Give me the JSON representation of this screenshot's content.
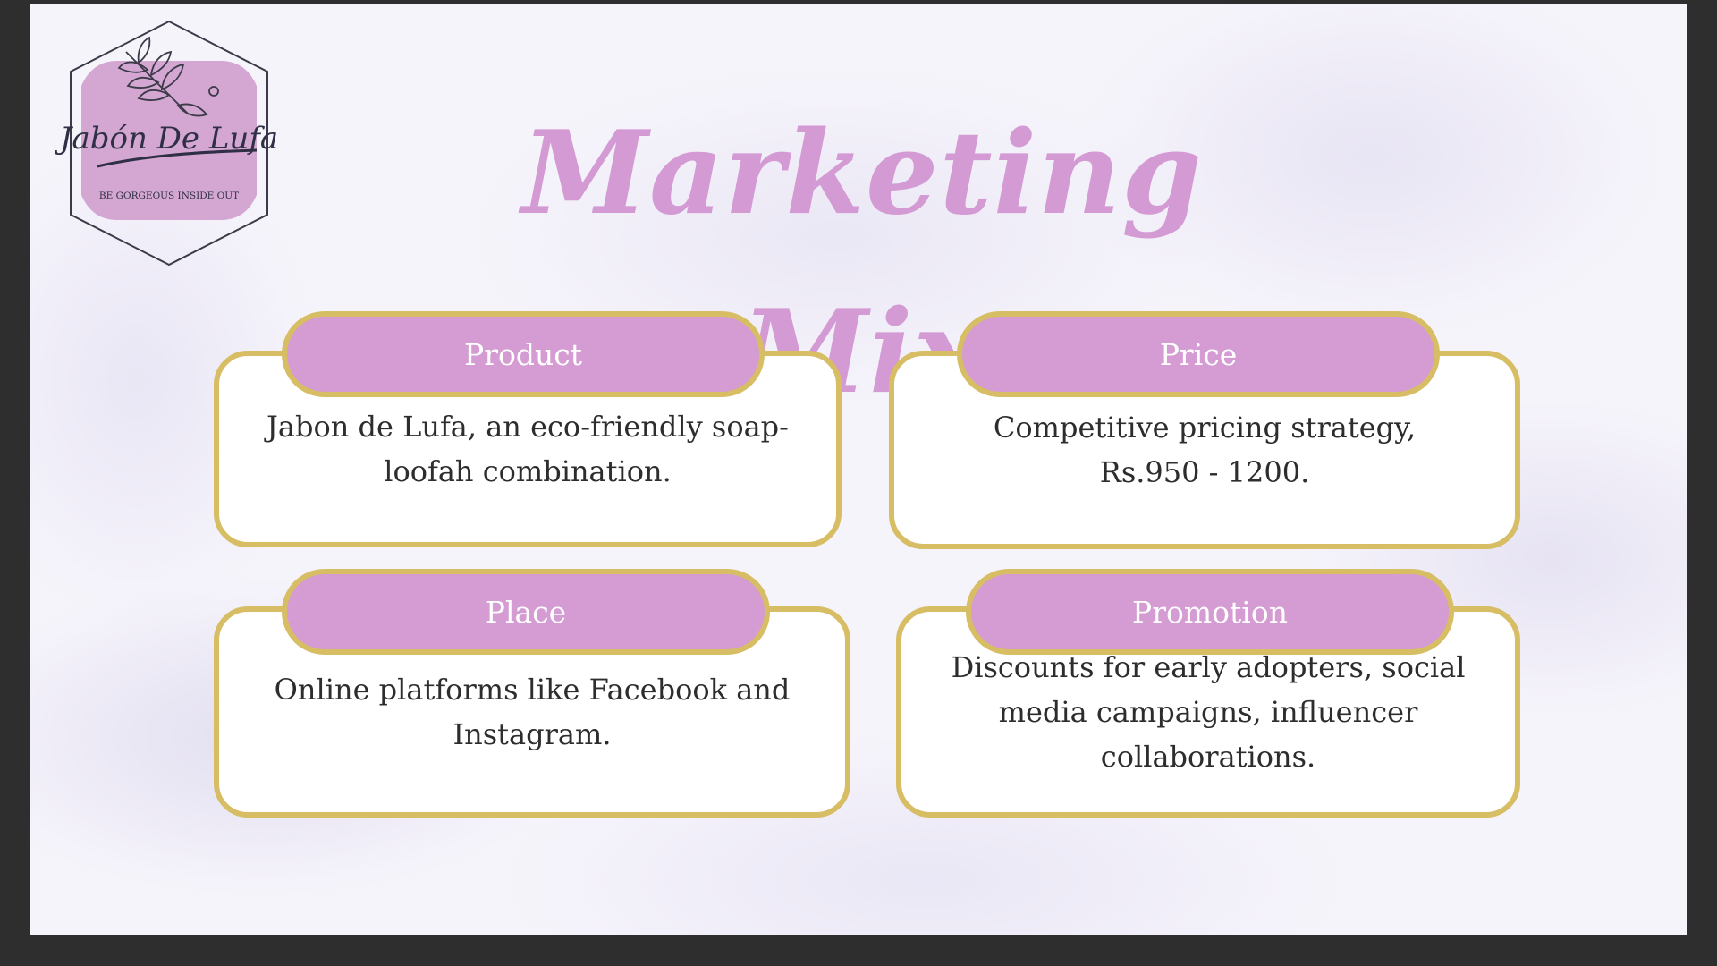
{
  "slide": {
    "title": "Marketing Mix"
  },
  "logo": {
    "brand": "Jabón De Lufa",
    "tagline": "BE GORGEOUS INSIDE OUT"
  },
  "cards": [
    {
      "heading": "Product",
      "text": "Jabon de Lufa, an eco-friendly soap-loofah combination."
    },
    {
      "heading": "Price",
      "text": "Competitive pricing strategy, Rs.950 - 1200."
    },
    {
      "heading": "Place",
      "text": "Online platforms like Facebook and Instagram."
    },
    {
      "heading": "Promotion",
      "text": "Discounts for early adopters, social media campaigns, influencer collaborations."
    }
  ],
  "colors": {
    "accent_pink": "#d49cd2",
    "border_gold": "#d7bd64",
    "frame": "#2e2e2e"
  },
  "icons": [
    "leaf-branch-icon"
  ]
}
